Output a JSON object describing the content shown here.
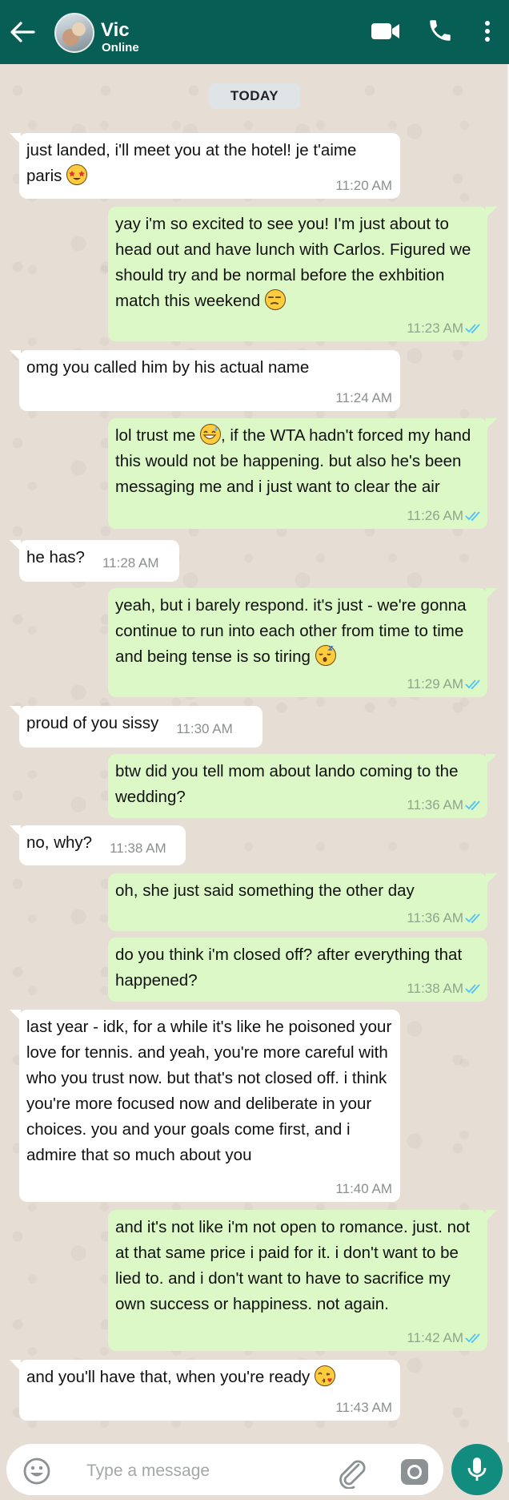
{
  "header": {
    "contact_name": "Vic",
    "status": "Online",
    "icons": [
      "back-arrow-icon",
      "avatar",
      "video-call-icon",
      "voice-call-icon",
      "more-vert-icon"
    ]
  },
  "date_chip": "TODAY",
  "messages": [
    {
      "dir": "in",
      "text": "just landed, i'll meet you at the hotel! je t'aime paris",
      "emoji": "star-struck-emoji",
      "time": "11:20 AM"
    },
    {
      "dir": "out",
      "text": "yay i'm so excited to see you! I'm just about to head out and have lunch with Carlos. Figured we should try and be normal before the exhbition match this weekend",
      "emoji": "unamused-face-emoji",
      "time": "11:23 AM",
      "read": true
    },
    {
      "dir": "in",
      "text": "omg you called him by his actual name",
      "time": "11:24 AM"
    },
    {
      "dir": "out",
      "text_before_emoji": "lol trust me",
      "emoji": "grinning-sweat-emoji",
      "text_after_emoji": ", if the WTA hadn't forced my hand this would not be happening. but also he's been messaging me and i just want to clear the air",
      "time": "11:26 AM",
      "read": true
    },
    {
      "dir": "in",
      "text": "he has?",
      "time": "11:28 AM"
    },
    {
      "dir": "out",
      "text": "yeah, but i barely respond. it's just - we're gonna continue to run into each other from time to time and being tense is so tiring",
      "emoji": "sleepy-face-emoji",
      "time": "11:29 AM",
      "read": true
    },
    {
      "dir": "in",
      "text": "proud of you sissy",
      "time": "11:30 AM"
    },
    {
      "dir": "out",
      "text": "btw did you tell mom about lando coming to the wedding?",
      "time": "11:36 AM",
      "read": true
    },
    {
      "dir": "in",
      "text": "no, why?",
      "time": "11:38 AM"
    },
    {
      "dir": "out",
      "text": "oh, she just said something the other day",
      "time": "11:36 AM",
      "read": true
    },
    {
      "dir": "out",
      "text": "do you think i'm closed off? after everything that happened?",
      "time": "11:38 AM",
      "read": true
    },
    {
      "dir": "in",
      "text": "last year - idk, for a while it's like he poisoned your love for tennis. and yeah, you're more careful with who you trust now. but that's not closed off. i think you're more focused now and deliberate in your choices. you and your goals come first, and i admire that so much about you",
      "time": "11:40 AM"
    },
    {
      "dir": "out",
      "text": "and it's not like i'm not open to romance. just. not at that same price i paid for it. i don't want to be lied to. and i don't want to have to sacrifice my own success or happiness. not again.",
      "time": "11:42 AM",
      "read": true
    },
    {
      "dir": "in",
      "text": "and you'll have that, when you're ready",
      "emoji": "kissing-heart-emoji",
      "time": "11:43 AM"
    }
  ],
  "input": {
    "placeholder": "Type a message",
    "icons": [
      "emoji-icon",
      "attach-icon",
      "camera-icon",
      "mic-icon"
    ]
  },
  "colors": {
    "header": "#075e54",
    "outgoing_bubble": "#dcf8c6",
    "incoming_bubble": "#ffffff",
    "chat_background": "#e6ded5",
    "read_tick": "#4fc3f7",
    "mic_button": "#128c7e"
  }
}
